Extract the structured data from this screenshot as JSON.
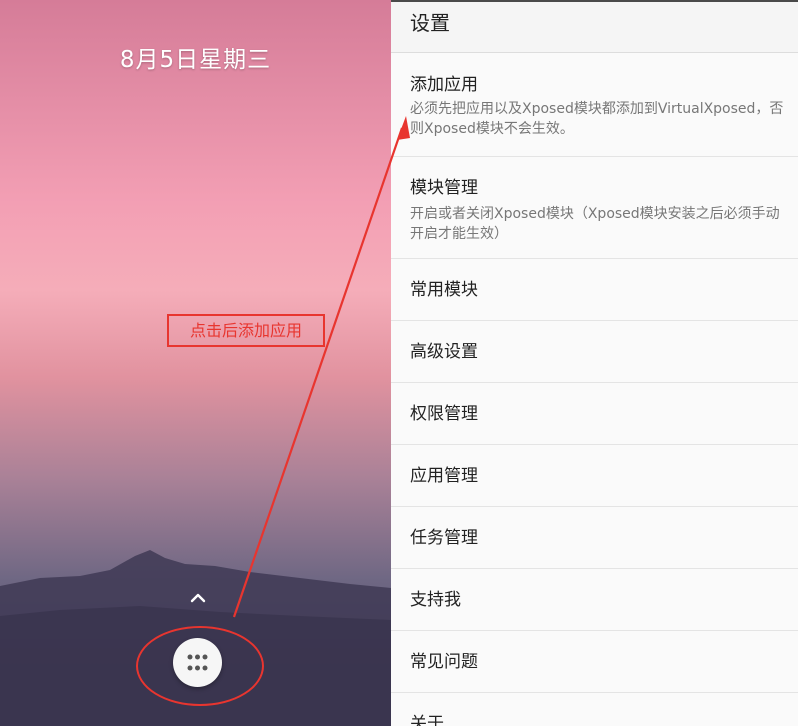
{
  "home": {
    "date": "8月5日星期三",
    "annotation": "点击后添加应用",
    "chevron_icon": "chevron-up-icon",
    "all_apps_icon": "app-grid-icon"
  },
  "settings": {
    "header": "设置",
    "items": [
      {
        "title": "添加应用",
        "summary": "必须先把应用以及Xposed模块都添加到VirtualXposed，否则Xposed模块不会生效。"
      },
      {
        "title": "模块管理",
        "summary": "开启或者关闭Xposed模块（Xposed模块安装之后必须手动开启才能生效）"
      },
      {
        "title": "常用模块"
      },
      {
        "title": "高级设置"
      },
      {
        "title": "权限管理"
      },
      {
        "title": "应用管理"
      },
      {
        "title": "任务管理"
      },
      {
        "title": "支持我"
      },
      {
        "title": "常见问题"
      },
      {
        "title": "关于"
      }
    ]
  },
  "colors": {
    "annotation_red": "#e8352f",
    "settings_bg": "#fafafa"
  }
}
